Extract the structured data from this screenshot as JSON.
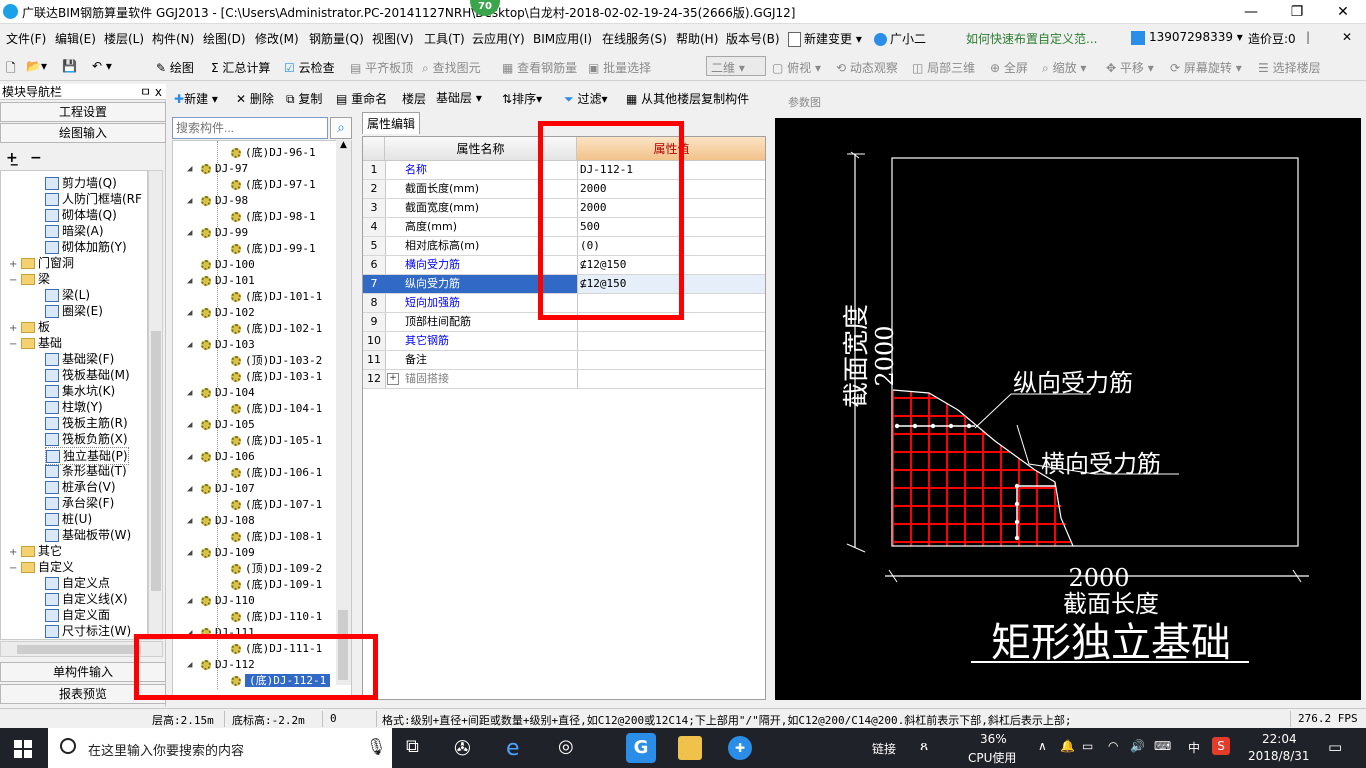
{
  "titlebar": {
    "title": "广联达BIM钢筋算量软件 GGJ2013 - [C:\\Users\\Administrator.PC-20141127NRH\\Desktop\\白龙村-2018-02-02-19-24-35(2666版).GGJ12]",
    "badge": "70",
    "minimize": "—",
    "restore": "❐",
    "close": "✕"
  },
  "menubar": {
    "items": [
      "文件(F)",
      "编辑(E)",
      "楼层(L)",
      "构件(N)",
      "绘图(D)",
      "修改(M)",
      "钢筋量(Q)",
      "视图(V)",
      "工具(T)",
      "云应用(Y)",
      "BIM应用(I)",
      "在线服务(S)",
      "帮助(H)",
      "版本号(B)"
    ],
    "new_change": "新建变更",
    "assistant": "广小二",
    "help_link": "如何快速布置自定义范...",
    "phone": "13907298339",
    "price_bean": "造价豆:0"
  },
  "toolbar": {
    "draw": "绘图",
    "summary": "汇总计算",
    "cloud_check": "云检查",
    "flat_board_top": "平齐板顶",
    "find_element": "查找图元",
    "view_rebar": "查看钢筋量",
    "batch_select": "批量选择",
    "view_mode": "二维",
    "top_view": "俯视",
    "dynamic_view": "动态观察",
    "local_3d": "局部三维",
    "full_screen": "全屏",
    "zoom": "缩放",
    "pan": "平移",
    "rotate": "屏幕旋转",
    "select_floor": "选择楼层"
  },
  "nav": {
    "header": "模块导航栏",
    "pin": "ㅁ x",
    "project_settings": "工程设置",
    "drawing_input": "绘图输入",
    "single_input": "单构件输入",
    "report_preview": "报表预览",
    "tree": [
      {
        "label": "剪力墙(Q)",
        "level": 2
      },
      {
        "label": "人防门框墙(RF",
        "level": 2
      },
      {
        "label": "砌体墙(Q)",
        "level": 2
      },
      {
        "label": "暗梁(A)",
        "level": 2
      },
      {
        "label": "砌体加筋(Y)",
        "level": 2
      },
      {
        "label": "门窗洞",
        "level": 1,
        "folder": true,
        "expand": "+"
      },
      {
        "label": "梁",
        "level": 1,
        "folder": true,
        "expand": "−"
      },
      {
        "label": "梁(L)",
        "level": 2
      },
      {
        "label": "圈梁(E)",
        "level": 2
      },
      {
        "label": "板",
        "level": 1,
        "folder": true,
        "expand": "+"
      },
      {
        "label": "基础",
        "level": 1,
        "folder": true,
        "expand": "−"
      },
      {
        "label": "基础梁(F)",
        "level": 2
      },
      {
        "label": "筏板基础(M)",
        "level": 2
      },
      {
        "label": "集水坑(K)",
        "level": 2
      },
      {
        "label": "柱墩(Y)",
        "level": 2
      },
      {
        "label": "筏板主筋(R)",
        "level": 2
      },
      {
        "label": "筏板负筋(X)",
        "level": 2
      },
      {
        "label": "独立基础(P)",
        "level": 2,
        "selected": true
      },
      {
        "label": "条形基础(T)",
        "level": 2
      },
      {
        "label": "桩承台(V)",
        "level": 2
      },
      {
        "label": "承台梁(F)",
        "level": 2
      },
      {
        "label": "桩(U)",
        "level": 2
      },
      {
        "label": "基础板带(W)",
        "level": 2
      },
      {
        "label": "其它",
        "level": 1,
        "folder": true,
        "expand": "+"
      },
      {
        "label": "自定义",
        "level": 1,
        "folder": true,
        "expand": "−"
      },
      {
        "label": "自定义点",
        "level": 2
      },
      {
        "label": "自定义线(X)",
        "level": 2
      },
      {
        "label": "自定义面",
        "level": 2
      },
      {
        "label": "尺寸标注(W)",
        "level": 2
      }
    ]
  },
  "complist": {
    "toolbar": {
      "new": "新建",
      "delete": "删除",
      "copy": "复制",
      "rename": "重命名",
      "floor_label": "楼层",
      "floor_value": "基础层",
      "sort": "排序",
      "filter": "过滤",
      "copy_from_floor": "从其他楼层复制构件"
    },
    "search_placeholder": "搜索构件...",
    "items": [
      {
        "label": "(底)DJ-96-1",
        "child": true
      },
      {
        "label": "DJ-97",
        "child": false
      },
      {
        "label": "(底)DJ-97-1",
        "child": true
      },
      {
        "label": "DJ-98",
        "child": false
      },
      {
        "label": "(底)DJ-98-1",
        "child": true
      },
      {
        "label": "DJ-99",
        "child": false
      },
      {
        "label": "(底)DJ-99-1",
        "child": true
      },
      {
        "label": "DJ-100",
        "child": false,
        "leaf": true
      },
      {
        "label": "DJ-101",
        "child": false
      },
      {
        "label": "(底)DJ-101-1",
        "child": true
      },
      {
        "label": "DJ-102",
        "child": false
      },
      {
        "label": "(底)DJ-102-1",
        "child": true
      },
      {
        "label": "DJ-103",
        "child": false
      },
      {
        "label": "(顶)DJ-103-2",
        "child": true
      },
      {
        "label": "(底)DJ-103-1",
        "child": true
      },
      {
        "label": "DJ-104",
        "child": false
      },
      {
        "label": "(底)DJ-104-1",
        "child": true
      },
      {
        "label": "DJ-105",
        "child": false
      },
      {
        "label": "(底)DJ-105-1",
        "child": true
      },
      {
        "label": "DJ-106",
        "child": false
      },
      {
        "label": "(底)DJ-106-1",
        "child": true
      },
      {
        "label": "DJ-107",
        "child": false
      },
      {
        "label": "(底)DJ-107-1",
        "child": true
      },
      {
        "label": "DJ-108",
        "child": false
      },
      {
        "label": "(底)DJ-108-1",
        "child": true
      },
      {
        "label": "DJ-109",
        "child": false
      },
      {
        "label": "(顶)DJ-109-2",
        "child": true
      },
      {
        "label": "(底)DJ-109-1",
        "child": true
      },
      {
        "label": "DJ-110",
        "child": false
      },
      {
        "label": "(底)DJ-110-1",
        "child": true
      },
      {
        "label": "DJ-111",
        "child": false
      },
      {
        "label": "(底)DJ-111-1",
        "child": true
      },
      {
        "label": "DJ-112",
        "child": false
      },
      {
        "label": "(底)DJ-112-1",
        "child": true,
        "selected": true
      }
    ]
  },
  "props": {
    "tab": "属性编辑",
    "col_name": "属性名称",
    "col_value": "属性值",
    "rows": [
      {
        "num": "1",
        "name": "名称",
        "value": "DJ-112-1",
        "blue": true
      },
      {
        "num": "2",
        "name": "截面长度(mm)",
        "value": "2000"
      },
      {
        "num": "3",
        "name": "截面宽度(mm)",
        "value": "2000"
      },
      {
        "num": "4",
        "name": "高度(mm)",
        "value": "500"
      },
      {
        "num": "5",
        "name": "相对底标高(m)",
        "value": "(0)"
      },
      {
        "num": "6",
        "name": "横向受力筋",
        "value": "⊈12@150",
        "blue": true
      },
      {
        "num": "7",
        "name": "纵向受力筋",
        "value": "⊈12@150",
        "blue": true,
        "selected": true
      },
      {
        "num": "8",
        "name": "短向加强筋",
        "value": "",
        "blue": true
      },
      {
        "num": "9",
        "name": "顶部柱间配筋",
        "value": ""
      },
      {
        "num": "10",
        "name": "其它钢筋",
        "value": "",
        "blue": true
      },
      {
        "num": "11",
        "name": "备注",
        "value": ""
      },
      {
        "num": "12",
        "name": "锚固搭接",
        "value": "",
        "gray": true,
        "expand": "+"
      }
    ]
  },
  "diagram": {
    "panel_title": "参数图",
    "width_label": "截面宽度",
    "width_value": "2000",
    "length_value": "2000",
    "length_label": "截面长度",
    "longitudinal_label": "纵向受力筋",
    "transverse_label": "横向受力筋",
    "caption": "矩形独立基础",
    "colors": {
      "rebar": "#ff0000",
      "background": "#000000",
      "lines": "#ffffff"
    }
  },
  "status": {
    "floor_height": "层高:2.15m",
    "bottom_elev": "底标高:-2.2m",
    "zero": "0",
    "hint": "格式:级别+直径+间距或数量+级别+直径,如C12@200或12C14;下上部用\"/\"隔开,如C12@200/C14@200.斜杠前表示下部,斜杠后表示上部;",
    "fps": "276.2 FPS"
  },
  "taskbar": {
    "search_placeholder": "在这里输入你要搜索的内容",
    "link": "链接",
    "cpu_percent": "36%",
    "cpu_label": "CPU使用",
    "ime": "中",
    "time": "22:04",
    "date": "2018/8/31"
  }
}
